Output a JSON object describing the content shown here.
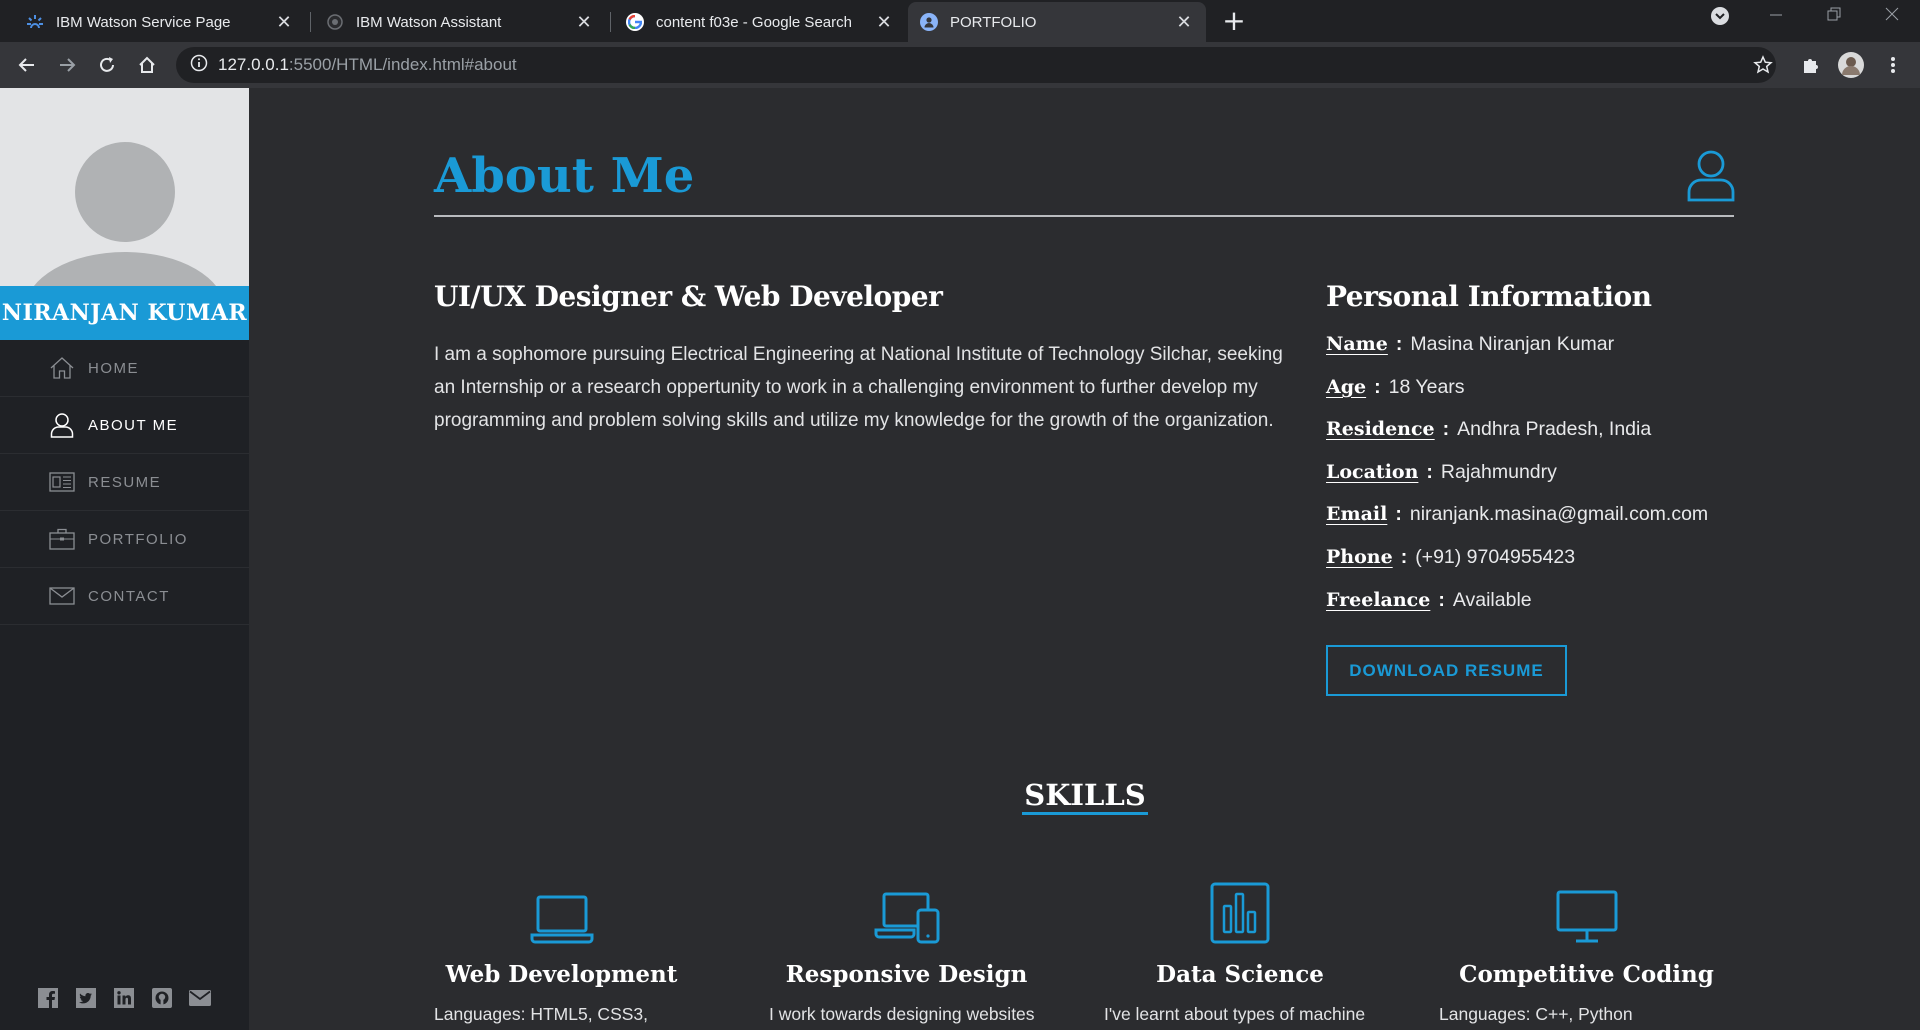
{
  "browser": {
    "tabs": [
      {
        "title": "IBM Watson Service Page",
        "close": "✕"
      },
      {
        "title": "IBM Watson Assistant",
        "close": "✕"
      },
      {
        "title": "content f03e - Google Search",
        "close": "✕"
      },
      {
        "title": "PORTFOLIO",
        "close": "✕"
      }
    ],
    "new_tab": "+",
    "url_host": "127.0.0.1",
    "url_path": ":5500/HTML/index.html#about"
  },
  "sidebar": {
    "name": "NIRANJAN KUMAR",
    "nav": [
      {
        "label": "HOME",
        "icon": "home-icon"
      },
      {
        "label": "ABOUT ME",
        "icon": "user-icon",
        "active": true
      },
      {
        "label": "RESUME",
        "icon": "resume-icon"
      },
      {
        "label": "PORTFOLIO",
        "icon": "briefcase-icon"
      },
      {
        "label": "CONTACT",
        "icon": "envelope-icon"
      }
    ],
    "social": [
      "facebook-icon",
      "twitter-icon",
      "linkedin-icon",
      "github-icon",
      "mail-icon"
    ]
  },
  "about": {
    "title": "About Me",
    "role": "UI/UX Designer & Web Developer",
    "bio": "I am a sophomore pursuing Electrical Engineering at National Institute of Technology Silchar, seeking an Internship or a research oppertunity to work in a challenging environment to further develop my programming and problem solving skills and utilize my knowledge for the growth of the organization.",
    "info_title": "Personal Information",
    "info": [
      {
        "label": "Name",
        "value": "Masina Niranjan Kumar"
      },
      {
        "label": "Age",
        "value": "18 Years"
      },
      {
        "label": "Residence",
        "value": "Andhra Pradesh, India"
      },
      {
        "label": "Location",
        "value": "Rajahmundry"
      },
      {
        "label": "Email",
        "value": "niranjank.masina@gmail.com.com"
      },
      {
        "label": "Phone",
        "value": "(+91) 9704955423"
      },
      {
        "label": "Freelance",
        "value": "Available"
      }
    ],
    "colon": ":",
    "download_button": "DOWNLOAD RESUME"
  },
  "skills": {
    "title": "SKILLS",
    "items": [
      {
        "name": "Web Development",
        "desc": "Languages: HTML5, CSS3,",
        "icon": "laptop-icon"
      },
      {
        "name": "Responsive Design",
        "desc": "I work towards designing websites",
        "icon": "devices-icon"
      },
      {
        "name": "Data Science",
        "desc": "I've learnt about types of machine",
        "icon": "bar-chart-icon"
      },
      {
        "name": "Competitive Coding",
        "desc": "Languages: C++, Python",
        "icon": "monitor-icon"
      }
    ]
  },
  "colors": {
    "accent": "#1a9ad6",
    "sidebar_bg": "#1f2125",
    "main_bg": "#2b2c2f"
  }
}
